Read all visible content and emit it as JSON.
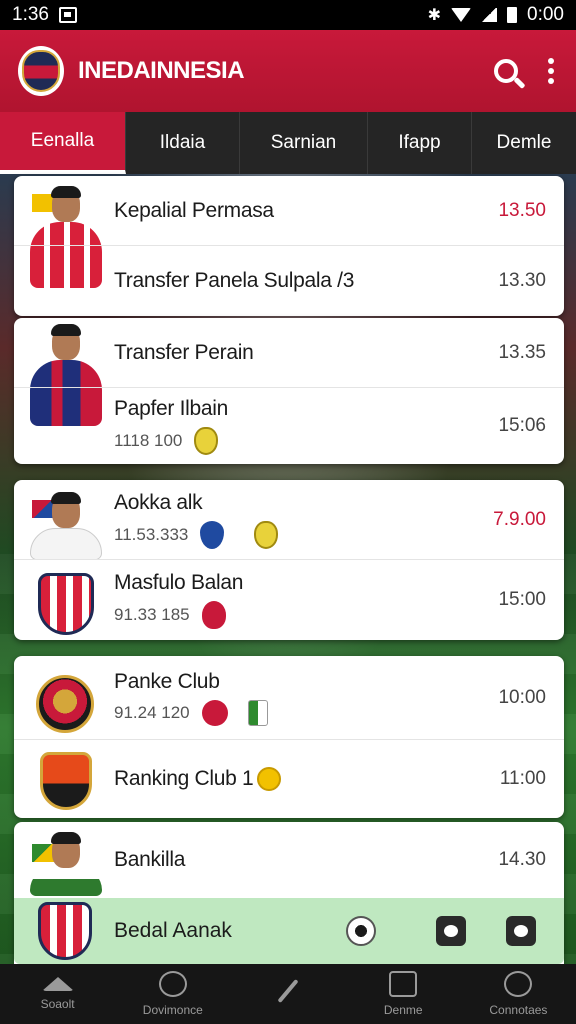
{
  "status_bar": {
    "time": "1:36",
    "right_time": "0:00"
  },
  "app_bar": {
    "title": "INEDAINNESIA"
  },
  "tabs": [
    {
      "label": "Eenalla",
      "active": true
    },
    {
      "label": "Ildaia",
      "active": false
    },
    {
      "label": "Sarnian",
      "active": false
    },
    {
      "label": "Ifapp",
      "active": false
    },
    {
      "label": "Demle",
      "active": false
    }
  ],
  "cards": [
    {
      "rows": [
        {
          "title": "Kepalial Permasa",
          "sub": "",
          "time": "13.50",
          "highlight": true
        },
        {
          "title": "Transfer Panela Sulpala /3",
          "sub": "",
          "time": "13.30",
          "highlight": false
        }
      ]
    },
    {
      "rows": [
        {
          "title": "Transfer Perain",
          "sub": "",
          "time": "13.35",
          "highlight": false
        },
        {
          "title": "Papfer Ilbain",
          "sub": "1118 100",
          "time": "15:06",
          "highlight": false
        }
      ]
    },
    {
      "rows": [
        {
          "title": "Aokka alk",
          "sub": "11.53.333",
          "time": "7.9.00",
          "highlight": true
        },
        {
          "title": "Masfulo Balan",
          "sub": "91.33 185",
          "time": "15:00",
          "highlight": false
        }
      ]
    },
    {
      "rows": [
        {
          "title": "Panke Club",
          "sub": "91.24 120",
          "time": "10:00",
          "highlight": false
        },
        {
          "title": "Ranking Club 1",
          "sub": "",
          "time": "11:00",
          "highlight": false
        }
      ]
    },
    {
      "rows": [
        {
          "title": "Bankilla",
          "sub": "",
          "time": "14.30",
          "highlight": false
        }
      ]
    }
  ],
  "strip": {
    "title": "Bedal Aanak"
  },
  "bottom_nav": [
    {
      "label": "Soaolt",
      "icon": "home-icon"
    },
    {
      "label": "Dovimonce",
      "icon": "search-icon"
    },
    {
      "label": "",
      "icon": "edit-icon"
    },
    {
      "label": "Denme",
      "icon": "cards-icon"
    },
    {
      "label": "Connotaes",
      "icon": "settings-icon"
    }
  ],
  "colors": {
    "brand_red": "#c8193a",
    "tab_bg": "#252525",
    "strip_green": "#bfe8c0"
  }
}
